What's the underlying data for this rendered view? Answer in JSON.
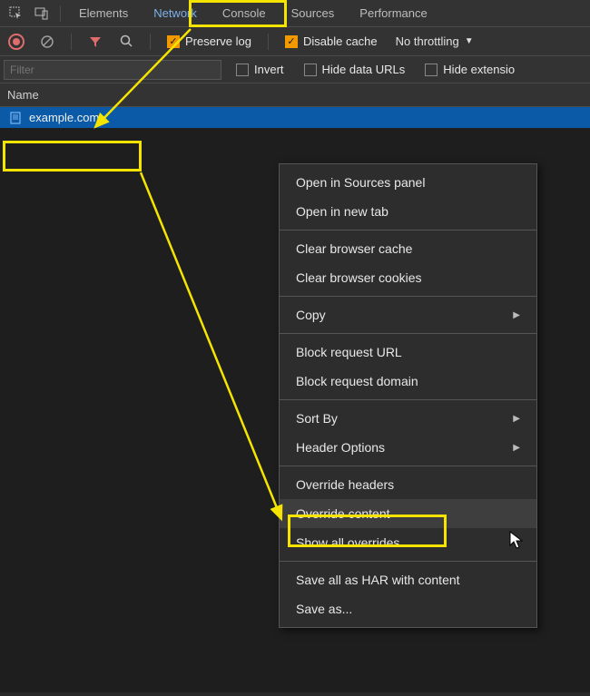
{
  "tabs": {
    "elements": "Elements",
    "network": "Network",
    "console": "Console",
    "sources": "Sources",
    "performance": "Performance"
  },
  "toolbar": {
    "preserve_log": "Preserve log",
    "disable_cache": "Disable cache",
    "throttling": "No throttling"
  },
  "filter": {
    "placeholder": "Filter",
    "invert": "Invert",
    "hide_data_urls": "Hide data URLs",
    "hide_extension": "Hide extensio"
  },
  "columns": {
    "name": "Name"
  },
  "requests": [
    {
      "name": "example.com"
    }
  ],
  "context_menu": {
    "open_sources": "Open in Sources panel",
    "open_tab": "Open in new tab",
    "clear_cache": "Clear browser cache",
    "clear_cookies": "Clear browser cookies",
    "copy": "Copy",
    "block_url": "Block request URL",
    "block_domain": "Block request domain",
    "sort_by": "Sort By",
    "header_options": "Header Options",
    "override_headers": "Override headers",
    "override_content": "Override content",
    "show_overrides": "Show all overrides",
    "save_har": "Save all as HAR with content",
    "save_as": "Save as..."
  }
}
